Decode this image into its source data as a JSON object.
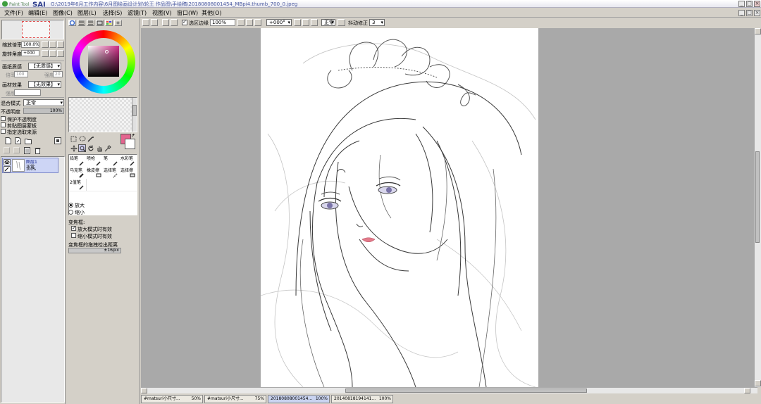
{
  "app": {
    "title": "SAI",
    "brand": "Paint Tool",
    "path": "G:\\2019年6月工作内容\\6月图绘画设计划\\轮王 作品图\\手绘稿\\20180808001454_MBpi4.thumb_700_0.jpeg"
  },
  "menu": [
    "文件(F)",
    "编辑(E)",
    "图像(C)",
    "图层(L)",
    "选择(S)",
    "滤镜(T)",
    "视图(V)",
    "窗口(W)",
    "其他(O)"
  ],
  "nav": {
    "zoom_label": "缩放倍率",
    "zoom_value": "100.0%",
    "angle_label": "旋转角度",
    "angle_value": "+000"
  },
  "paper_texture": {
    "label": "画纸质感",
    "value": "【无质感】",
    "sub1": "倍率",
    "sub1_val": "100",
    "sub2": "强度",
    "sub2_val": "20"
  },
  "paper_effect": {
    "label": "画材效果",
    "value": "【无效果】",
    "sub1": "强度"
  },
  "blend": {
    "label": "混合模式",
    "value": "正常"
  },
  "opacity": {
    "label": "不透明度",
    "value": "100%"
  },
  "layer_options": [
    "保护不透明度",
    "剪贴图层蒙板",
    "指定选取来源"
  ],
  "layers": [
    {
      "name": "图层1",
      "mode": "正常",
      "opacity": "100%"
    }
  ],
  "color": {
    "current": "#e4658f"
  },
  "tools": {
    "brushes": [
      "铅笔",
      "喷枪",
      "笔",
      "水彩笔",
      "马克笔",
      "橡皮擦",
      "选择笔",
      "选择擦",
      "2值笔"
    ]
  },
  "zoom_tool": {
    "zoom_in": "放大",
    "zoom_out": "缩小",
    "select_frame": "变焦框:",
    "frame_in": "放大模式时有效",
    "frame_out": "缩小模式时有效",
    "drag_threshold_label": "变焦框的拖拽检出距离",
    "drag_threshold_value": "±16pix"
  },
  "toolbar": {
    "selection_edge": "选区边缘",
    "zoom": "100%",
    "angle": "+000°",
    "mode": "正常",
    "stabilizer_label": "抖动修正",
    "stabilizer_value": "3"
  },
  "tabs": [
    {
      "name": "#matsuri小尺寸...",
      "pct": "50%",
      "active": false
    },
    {
      "name": "#matsuri小尺寸...",
      "pct": "75%",
      "active": false
    },
    {
      "name": "20180808001454...",
      "pct": "100%",
      "active": true
    },
    {
      "name": "20140818194141...",
      "pct": "100%",
      "active": false
    }
  ]
}
